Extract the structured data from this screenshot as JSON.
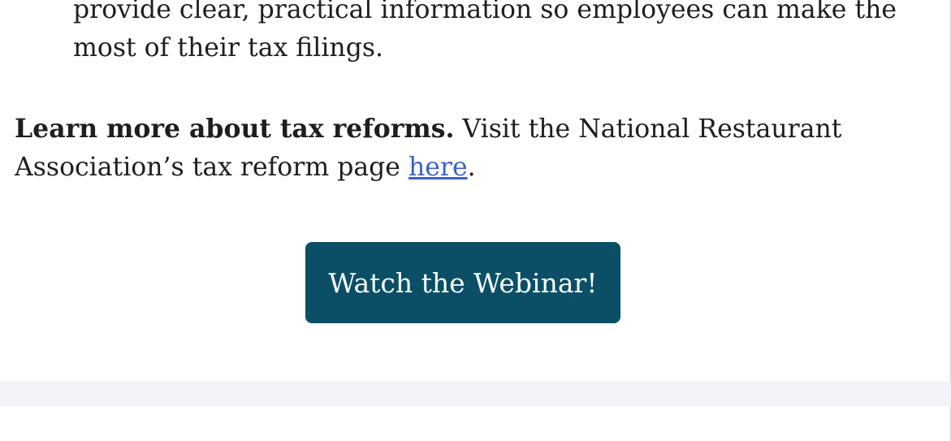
{
  "article": {
    "list_continuation": "provide clear, practical information so employees can make the most of their tax filings.",
    "learn_more": {
      "bold_lead": "Learn more about tax reforms.",
      "text_before_link": " Visit the National Restaurant Association’s tax reform page ",
      "link_label": "here",
      "text_after_link": "."
    }
  },
  "cta": {
    "label": "Watch the Webinar!",
    "background_color": "#0b4f66",
    "text_color": "#ffffff"
  },
  "colors": {
    "link": "#3b62c4",
    "body_text": "#1e1e1e",
    "footer_band": "#f1f3f8"
  }
}
